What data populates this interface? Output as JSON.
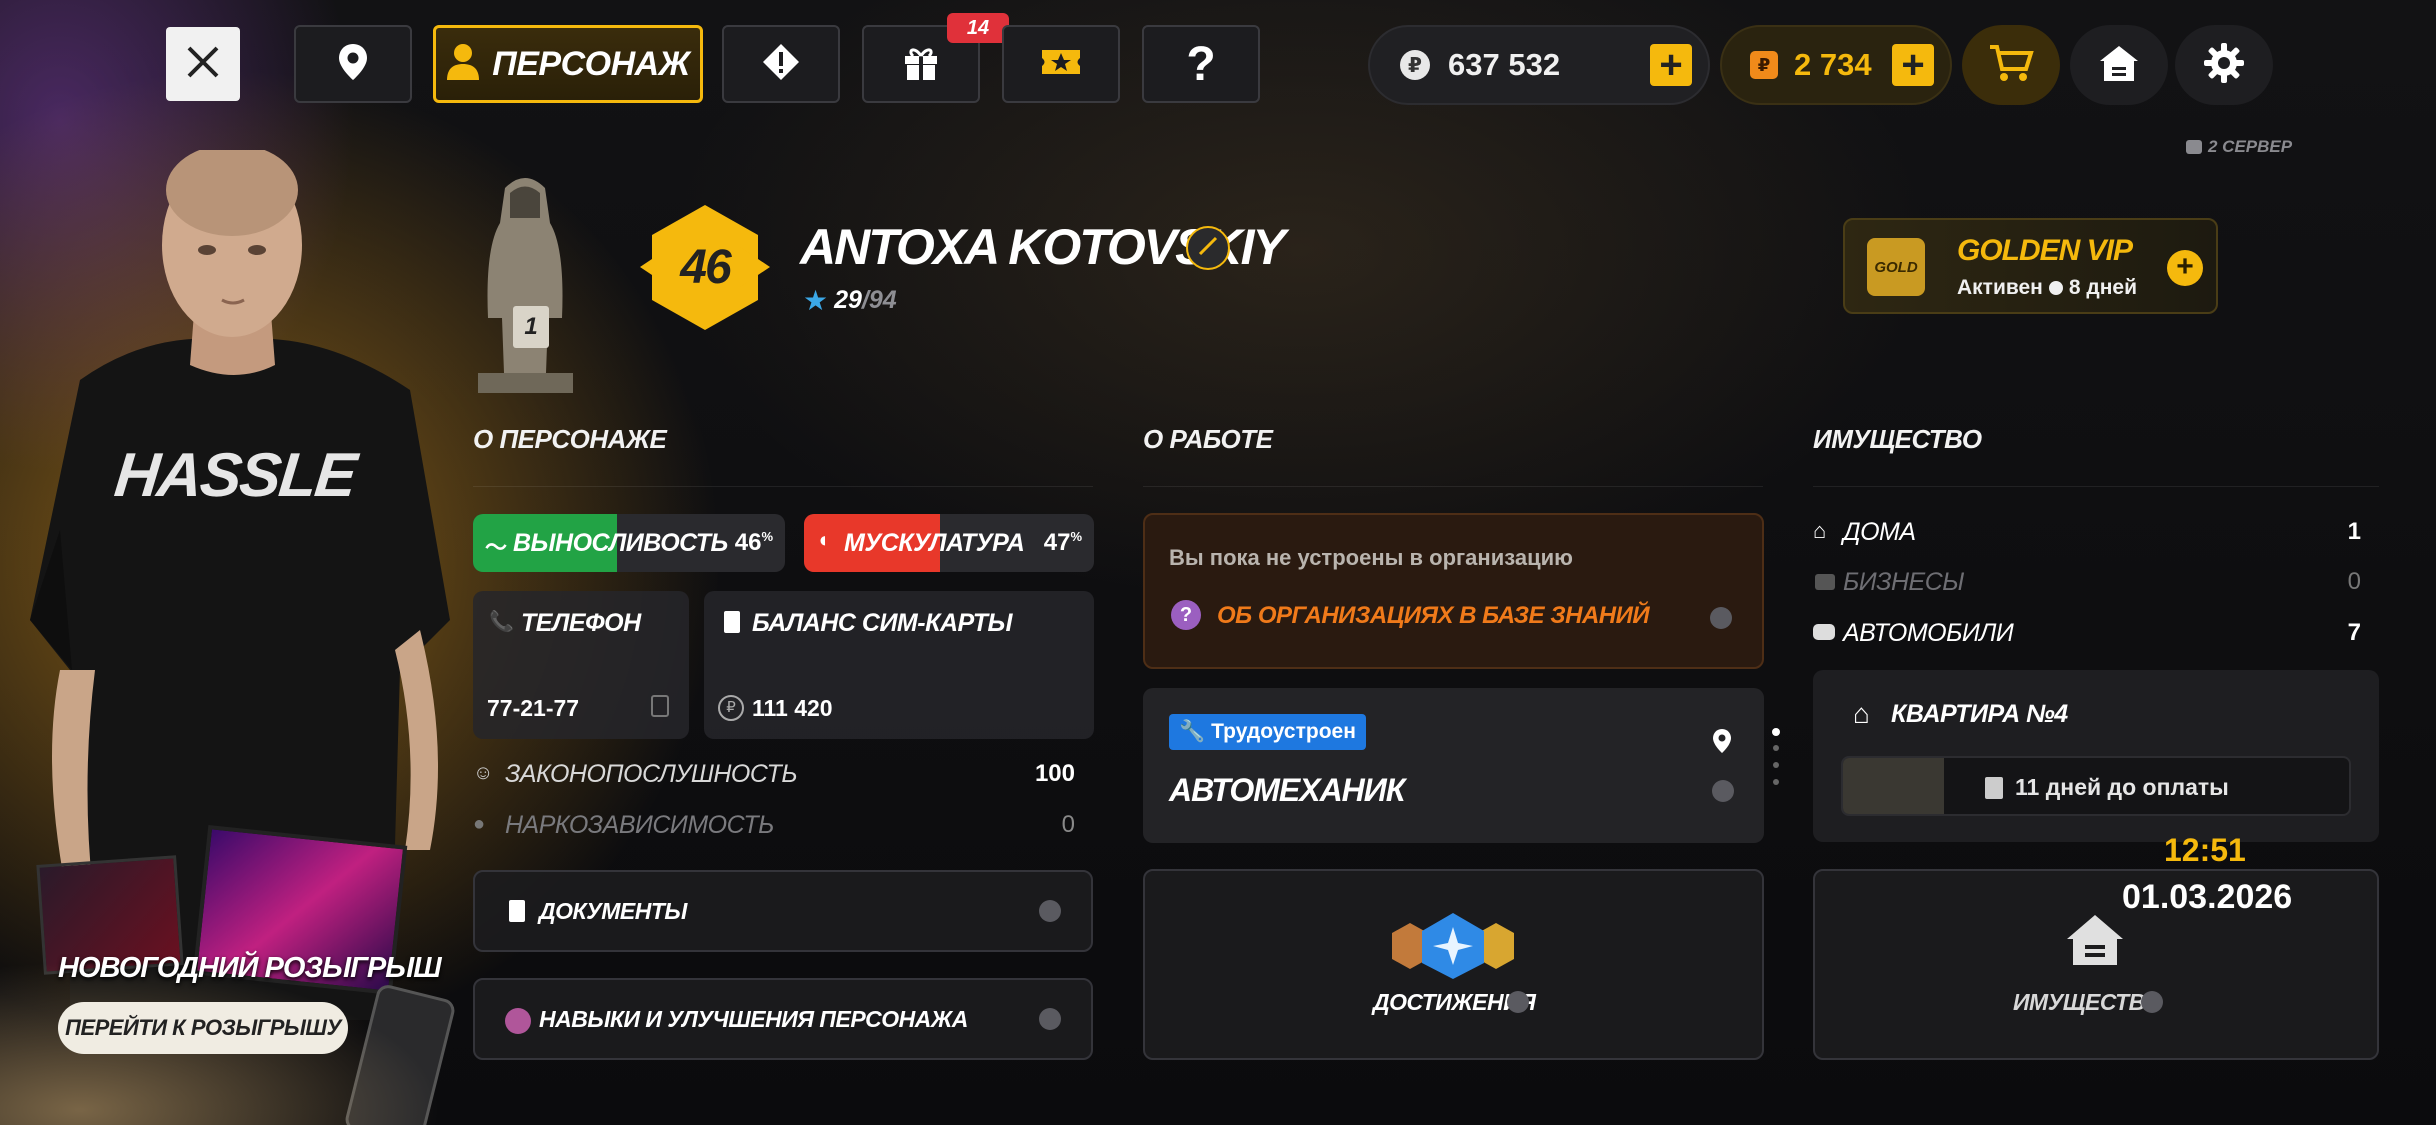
{
  "topbar": {
    "tab_character": "ПЕРСОНАЖ",
    "gifts_badge": "14",
    "money": "637 532",
    "coins": "2 734"
  },
  "server_label": "2 СЕРВЕР",
  "player": {
    "level": "46",
    "name": "ANTOXA KOTOVSKIY",
    "xp_current": "29",
    "xp_total": "/94",
    "statue_rank": "1"
  },
  "vip": {
    "logo_text": "GOLD",
    "title": "GOLDEN VIP",
    "status": "Активен",
    "days": "8 дней"
  },
  "about": {
    "title": "О ПЕРСОНАЖЕ",
    "stamina_label": "ВЫНОСЛИВОСТЬ",
    "stamina_value": "46",
    "muscle_label": "МУСКУЛАТУРА",
    "muscle_value": "47",
    "percent": "%",
    "stamina_level": 0.46,
    "muscle_level": 0.47,
    "phone_label": "ТЕЛЕФОН",
    "phone_value": "77-21-77",
    "sim_label": "БАЛАНС СИМ-КАРТЫ",
    "sim_value": "111 420",
    "law_label": "ЗАКОНОПОСЛУШНОСТЬ",
    "law_value": "100",
    "drug_label": "НАРКОЗАВИСИМОСТЬ",
    "drug_value": "0",
    "documents": "ДОКУМЕНТЫ",
    "skills": "НАВЫКИ И УЛУЧШЕНИЯ ПЕРСОНАЖА"
  },
  "work": {
    "title": "О РАБОТЕ",
    "no_org": "Вы пока не устроены в организацию",
    "org_link": "ОБ ОРГАНИЗАЦИЯХ В БАЗЕ ЗНАНИЙ",
    "employed_badge": "Трудоустроен",
    "job": "АВТОМЕХАНИК",
    "achievements": "ДОСТИЖЕНИЯ"
  },
  "property": {
    "title": "ИМУЩЕСТВО",
    "houses_label": "ДОМА",
    "houses_value": "1",
    "business_label": "БИЗНЕСЫ",
    "business_value": "0",
    "cars_label": "АВТОМОБИЛИ",
    "cars_value": "7",
    "apartment": "КВАРТИРА №4",
    "payment": "11 дней до оплаты",
    "payment_level": 0.2,
    "time": "12:51",
    "date": "01.03.2026",
    "property_button": "ИМУЩЕСТВО"
  },
  "promo": {
    "title": "НОВОГОДНИЙ РОЗЫГРЫШ",
    "button": "ПЕРЕЙТИ К РОЗЫГРЫШУ",
    "tshirt_text": "HASSLE"
  },
  "colors": {
    "accent": "#f5b90d",
    "stamina": "#22a345",
    "muscle": "#e8382a",
    "org_link": "#f07a1a",
    "employed": "#1e78e0"
  }
}
